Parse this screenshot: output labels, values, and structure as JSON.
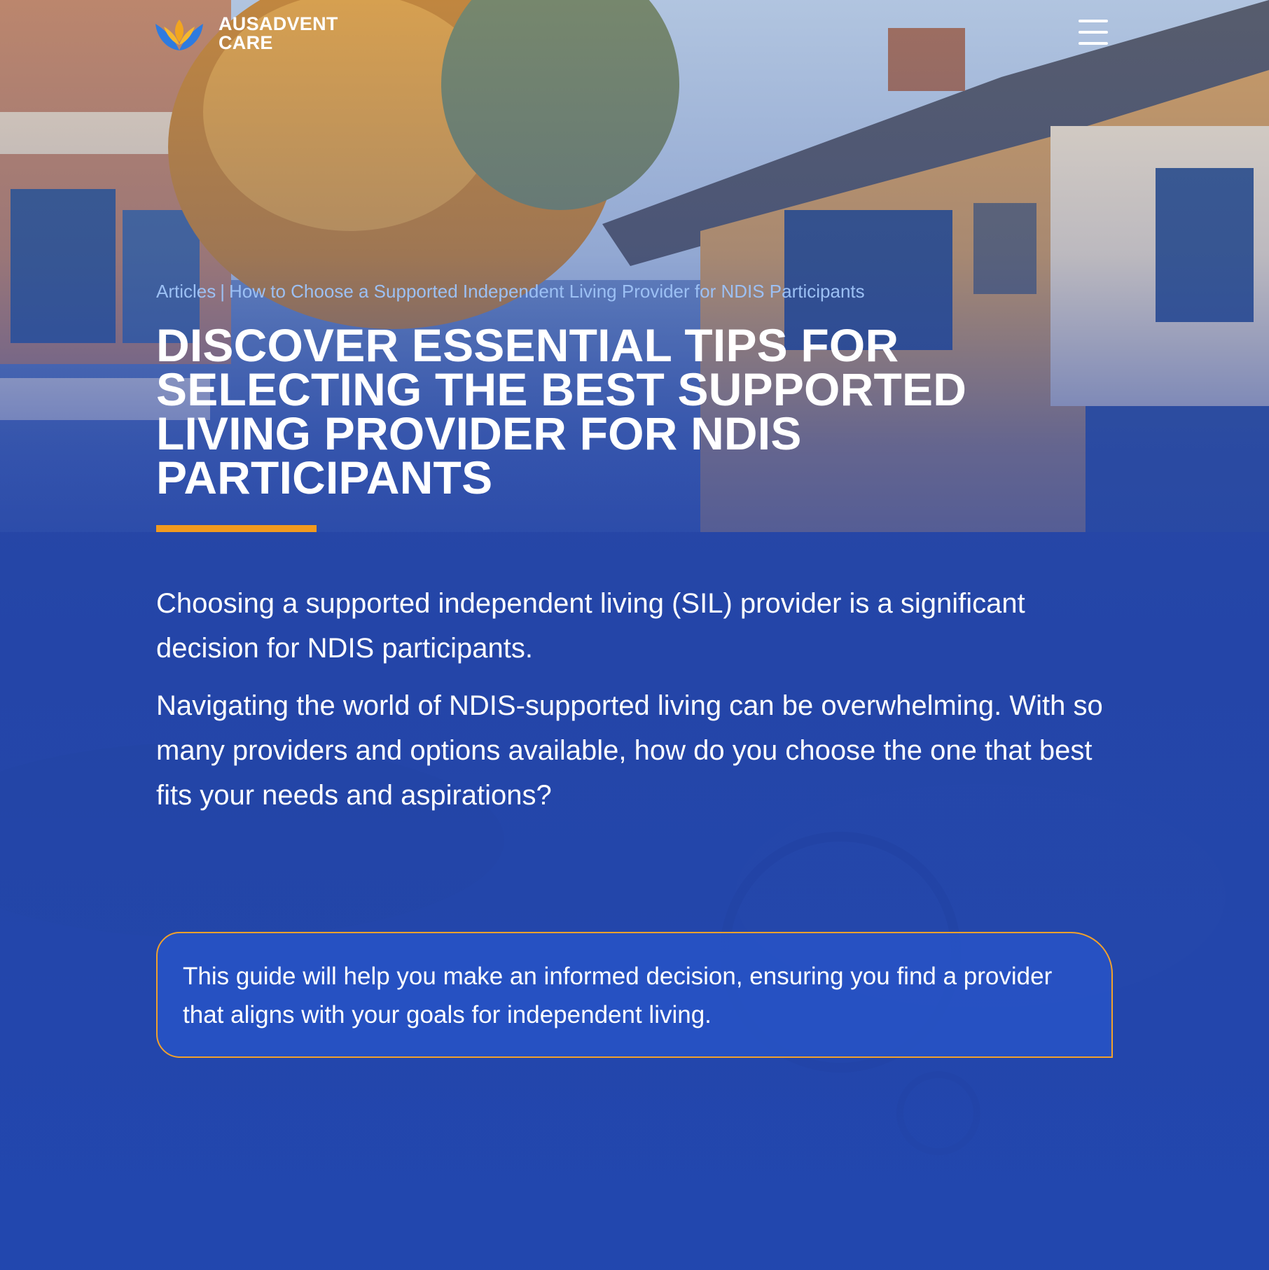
{
  "header": {
    "logo_line1": "AUSADVENT",
    "logo_line2": "CARE",
    "menu_icon": "hamburger-menu-icon"
  },
  "breadcrumb": {
    "parent": "Articles",
    "separator": "|",
    "current": "How to Choose a Supported Independent Living Provider for NDIS Participants"
  },
  "hero": {
    "title": "DISCOVER ESSENTIAL TIPS FOR SELECTING THE BEST SUPPORTED LIVING PROVIDER FOR NDIS PARTICIPANTS"
  },
  "intro": {
    "paragraph1": "Choosing a supported independent living (SIL) provider is a significant decision for NDIS participants.",
    "paragraph2": "Navigating the world of NDIS-supported living can be overwhelming. With so many providers and options available, how do you choose the one that best fits your needs and aspirations?"
  },
  "callout": {
    "text": "This guide will help you make an informed decision, ensuring you find a provider that aligns with your goals for independent living."
  },
  "colors": {
    "brand_blue": "#2146a6",
    "accent_orange": "#f29a1e",
    "breadcrumb_text": "#9cc0f4",
    "text_white": "#ffffff"
  }
}
